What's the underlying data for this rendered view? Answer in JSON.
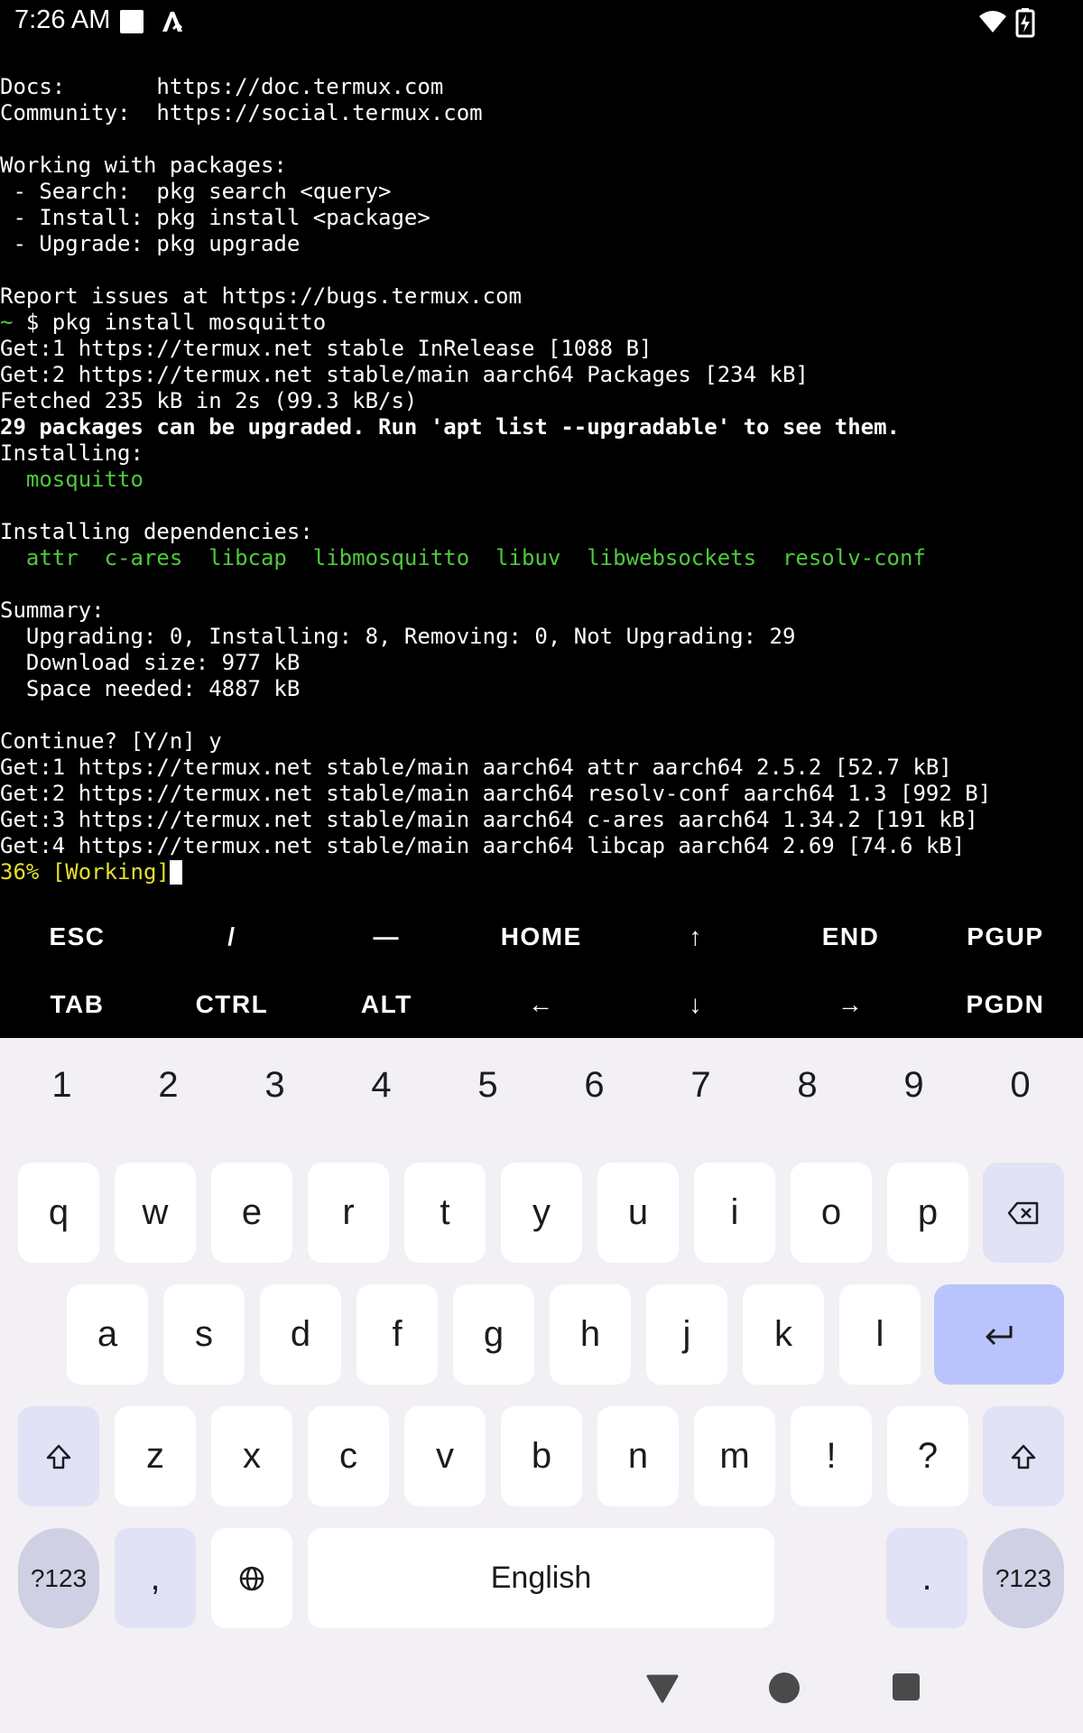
{
  "status_bar": {
    "time": "7:26 AM"
  },
  "terminal": {
    "lines": [
      "Docs:       https://doc.termux.com",
      "Community:  https://social.termux.com",
      "",
      "Working with packages:",
      " - Search:  pkg search <query>",
      " - Install: pkg install <package>",
      " - Upgrade: pkg upgrade",
      "",
      "Report issues at https://bugs.termux.com",
      {
        "prompt": "~",
        "cmd": " $ pkg install mosquitto"
      },
      "Get:1 https://termux.net stable InRelease [1088 B]",
      "Get:2 https://termux.net stable/main aarch64 Packages [234 kB]",
      "Fetched 235 kB in 2s (99.3 kB/s)",
      {
        "bold": "29 packages can be upgraded. Run 'apt list --upgradable' to see them."
      },
      "Installing:",
      {
        "green": "  mosquitto"
      },
      "",
      "Installing dependencies:",
      {
        "green": "  attr  c-ares  libcap  libmosquitto  libuv  libwebsockets  resolv-conf"
      },
      "",
      "Summary:",
      "  Upgrading: 0, Installing: 8, Removing: 0, Not Upgrading: 29",
      "  Download size: 977 kB",
      "  Space needed: 4887 kB",
      "",
      "Continue? [Y/n] y",
      "Get:1 https://termux.net stable/main aarch64 attr aarch64 2.5.2 [52.7 kB]",
      "Get:2 https://termux.net stable/main aarch64 resolv-conf aarch64 1.3 [992 B]",
      "Get:3 https://termux.net stable/main aarch64 c-ares aarch64 1.34.2 [191 kB]",
      "Get:4 https://termux.net stable/main aarch64 libcap aarch64 2.69 [74.6 kB]",
      {
        "yellow": "36% [Working]",
        "cursor": true
      }
    ]
  },
  "extra_keys": {
    "row1": [
      "ESC",
      "/",
      "—",
      "HOME",
      "↑",
      "END",
      "PGUP"
    ],
    "row2": [
      "TAB",
      "CTRL",
      "ALT",
      "←",
      "↓",
      "→",
      "PGDN"
    ]
  },
  "keyboard": {
    "numbers": [
      "1",
      "2",
      "3",
      "4",
      "5",
      "6",
      "7",
      "8",
      "9",
      "0"
    ],
    "row1": [
      "q",
      "w",
      "e",
      "r",
      "t",
      "y",
      "u",
      "i",
      "o",
      "p"
    ],
    "row2": [
      "a",
      "s",
      "d",
      "f",
      "g",
      "h",
      "j",
      "k",
      "l"
    ],
    "row3": [
      "z",
      "x",
      "c",
      "v",
      "b",
      "n",
      "m",
      "!",
      "?"
    ],
    "symbols_label": "?123",
    "comma": ",",
    "space_label": "English",
    "period": "."
  },
  "theme": {
    "background": "#000000",
    "prompt_green": "#4ec93c",
    "progress_yellow": "#e6e02a",
    "keyboard_bg": "#f2f0f4",
    "enter_key": "#b8c4fb"
  }
}
